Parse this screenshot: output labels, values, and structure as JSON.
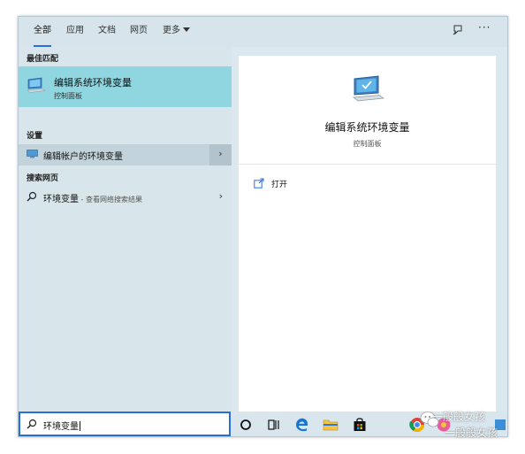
{
  "tabs": [
    {
      "label": "全部"
    },
    {
      "label": "应用"
    },
    {
      "label": "文档"
    },
    {
      "label": "网页"
    },
    {
      "label": "更多"
    }
  ],
  "top_icons": {
    "feedback": "feedback-icon",
    "more": "···"
  },
  "sections": {
    "best_match": "最佳匹配",
    "settings": "设置",
    "web": "搜索网页"
  },
  "best_match": {
    "title": "编辑系统环境变量",
    "subtitle": "控制面板",
    "icon": "computer-monitor-icon"
  },
  "settings_item": {
    "label": "编辑帐户的环境变量",
    "chevron": "›"
  },
  "web_item": {
    "label": "环境变量",
    "hint": " - 查看网络搜索结果",
    "chevron": "›"
  },
  "preview": {
    "title": "编辑系统环境变量",
    "subtitle": "控制面板",
    "actions": [
      {
        "label": "打开",
        "icon": "open-icon"
      }
    ]
  },
  "search": {
    "query": "环境变量"
  },
  "taskbar": {
    "icons": [
      "cortana-icon",
      "task-view-icon",
      "edge-icon",
      "file-explorer-icon",
      "store-icon",
      "chrome-icon",
      "app-icon"
    ]
  },
  "watermark": {
    "line1": "一般般女孩",
    "line2": "一般般女孩"
  },
  "colors": {
    "accent": "#2a6fd6",
    "highlight": "#8fd6e0",
    "panel": "#d8e6ec"
  }
}
